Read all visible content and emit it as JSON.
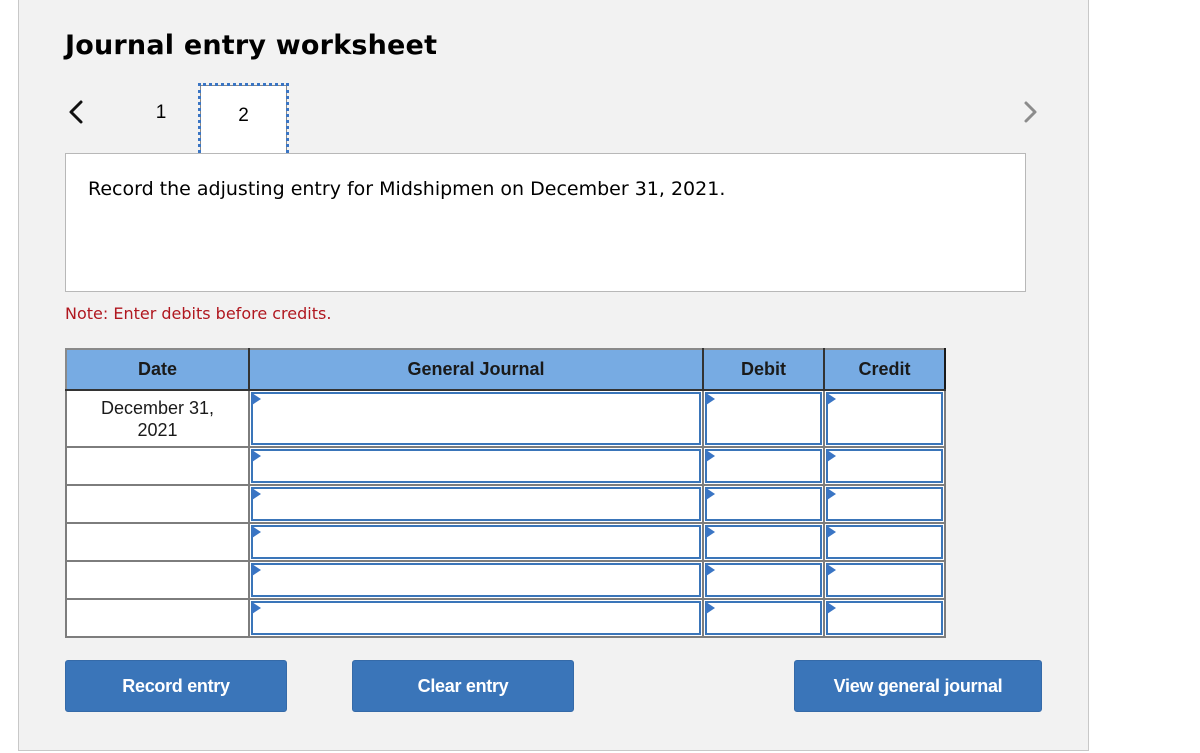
{
  "title": "Journal entry worksheet",
  "navigation": {
    "prev_icon": "chevron-left-icon",
    "next_icon": "chevron-right-icon",
    "tabs": [
      {
        "label": "1",
        "active": false
      },
      {
        "label": "2",
        "active": true
      }
    ]
  },
  "prompt": "Record the adjusting entry for Midshipmen on December 31, 2021.",
  "note": "Note: Enter debits before credits.",
  "table": {
    "headers": {
      "date": "Date",
      "general_journal": "General Journal",
      "debit": "Debit",
      "credit": "Credit"
    },
    "rows": [
      {
        "date": "December 31, 2021",
        "account": "",
        "debit": "",
        "credit": ""
      },
      {
        "date": "",
        "account": "",
        "debit": "",
        "credit": ""
      },
      {
        "date": "",
        "account": "",
        "debit": "",
        "credit": ""
      },
      {
        "date": "",
        "account": "",
        "debit": "",
        "credit": ""
      },
      {
        "date": "",
        "account": "",
        "debit": "",
        "credit": ""
      },
      {
        "date": "",
        "account": "",
        "debit": "",
        "credit": ""
      }
    ]
  },
  "buttons": {
    "record": "Record entry",
    "clear": "Clear entry",
    "view": "View general journal"
  },
  "colors": {
    "header_bg": "#77abe3",
    "button_bg": "#3a75b9",
    "note_text": "#b0171f",
    "panel_bg": "#f2f2f2"
  }
}
